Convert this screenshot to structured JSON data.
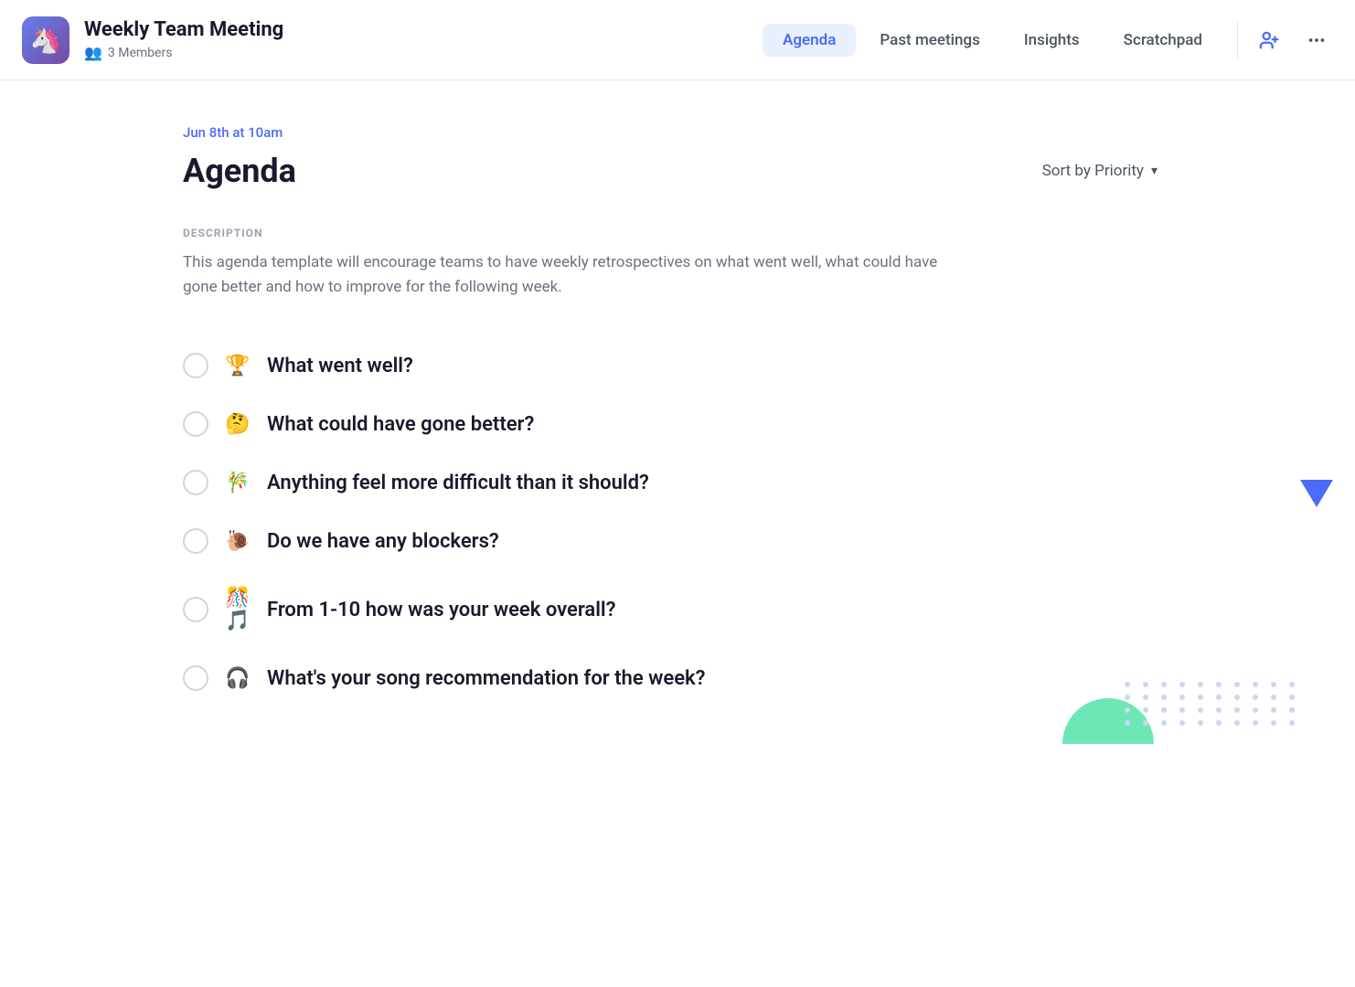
{
  "header": {
    "app_icon": "🦄",
    "meeting_title": "Weekly Team Meeting",
    "members_count": "3 Members",
    "nav_tabs": [
      {
        "id": "agenda",
        "label": "Agenda",
        "active": true
      },
      {
        "id": "past-meetings",
        "label": "Past meetings",
        "active": false
      },
      {
        "id": "insights",
        "label": "Insights",
        "active": false
      },
      {
        "id": "scratchpad",
        "label": "Scratchpad",
        "active": false
      }
    ],
    "add_person_label": "Add person",
    "more_options_label": "More options"
  },
  "main": {
    "date_label": "Jun 8th at 10am",
    "agenda_title": "Agenda",
    "sort_label": "Sort by Priority",
    "description_section_label": "DESCRIPTION",
    "description_text": "This agenda template will encourage teams to have weekly retrospectives on what went well, what could have gone better and how to improve for the following week.",
    "agenda_items": [
      {
        "id": 1,
        "emoji": "🏆",
        "text": "What went well?"
      },
      {
        "id": 2,
        "emoji": "🤔",
        "text": "What could have gone better?"
      },
      {
        "id": 3,
        "emoji": "🎋",
        "text": "Anything feel more difficult than it should?"
      },
      {
        "id": 4,
        "emoji": "🐌",
        "text": "Do we have any blockers?"
      },
      {
        "id": 5,
        "emoji": "🎊🎵",
        "text": "From 1-10 how was your week overall?"
      },
      {
        "id": 6,
        "emoji": "🎧",
        "text": "What's your song recommendation for the week?"
      }
    ]
  },
  "decorative": {
    "dots_count": 40,
    "triangle_color": "#4a6cf7",
    "hill_color": "#6ee7b7"
  }
}
